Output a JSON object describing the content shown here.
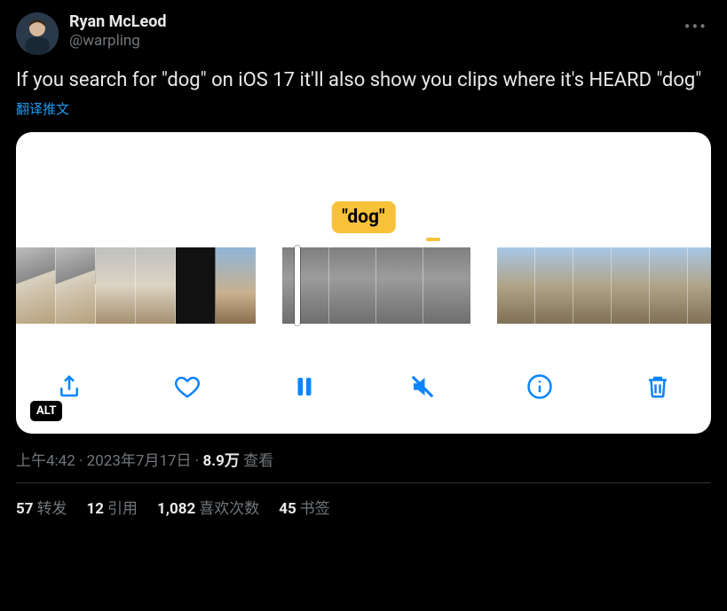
{
  "author": {
    "display_name": "Ryan McLeod",
    "handle": "@warpling"
  },
  "tweet_text": "If you search for \"dog\" on iOS 17 it'll also show you clips where it's HEARD \"dog\"",
  "translate_label": "翻译推文",
  "media": {
    "tooltip": "\"dog\"",
    "alt_badge": "ALT"
  },
  "meta": {
    "time": "上午4:42",
    "date": "2023年7月17日",
    "views_number": "8.9万",
    "views_label": "查看"
  },
  "stats": {
    "retweets_num": "57",
    "retweets_label": "转发",
    "quotes_num": "12",
    "quotes_label": "引用",
    "likes_num": "1,082",
    "likes_label": "喜欢次数",
    "bookmarks_num": "45",
    "bookmarks_label": "书签"
  }
}
